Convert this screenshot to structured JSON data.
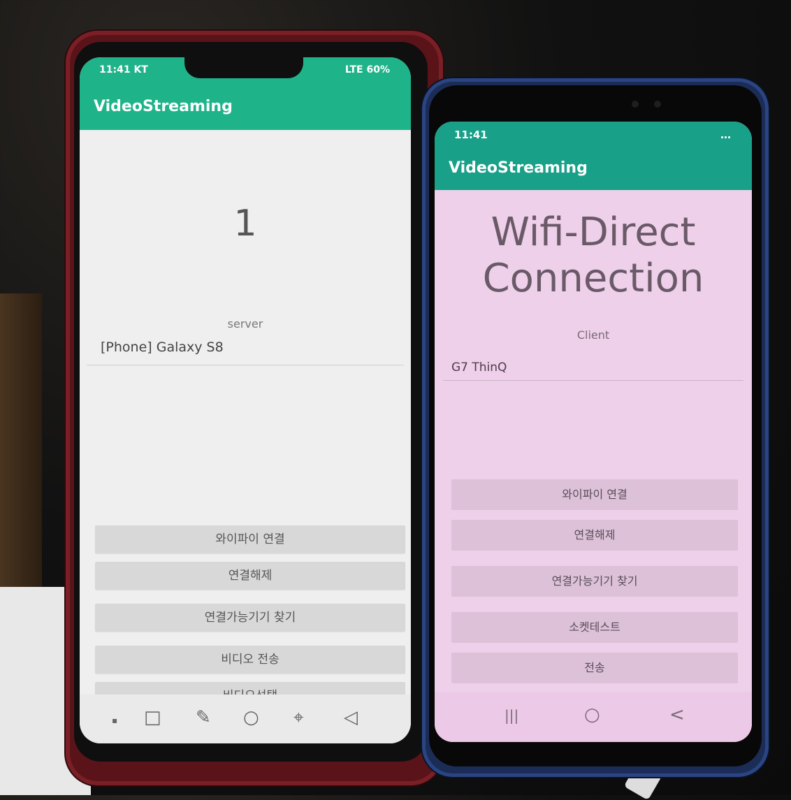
{
  "phone1": {
    "status": {
      "time": "11:41 KT",
      "indicators": "LTE 60%"
    },
    "app_title": "VideoStreaming",
    "number": "1",
    "role": "server",
    "device": "[Phone] Galaxy S8",
    "buttons": [
      "와이파이 연결",
      "연결해제",
      "연결가능기기 찾기",
      "비디오 전송",
      "비디오선택"
    ],
    "nav": [
      "▪",
      "□",
      "✎",
      "○",
      "⌖",
      "◁"
    ]
  },
  "phone2": {
    "status": {
      "time": "11:41",
      "indicators": "…"
    },
    "app_title": "VideoStreaming",
    "heading": {
      "line1": "Wifi-Direct",
      "line2": "Connection"
    },
    "role": "Client",
    "device": "G7 ThinQ",
    "buttons": [
      "와이파이 연결",
      "연결해제",
      "연결가능기기 찾기",
      "소켓테스트",
      "전송"
    ],
    "nav": [
      "|||",
      "○",
      "<"
    ]
  },
  "colors": {
    "phone1_accent": "#1fb38a",
    "phone2_accent": "#19a088",
    "phone2_screen": "#efd0ea",
    "phone1_case": "#5a1419",
    "phone2_case": "#1b2d57"
  }
}
